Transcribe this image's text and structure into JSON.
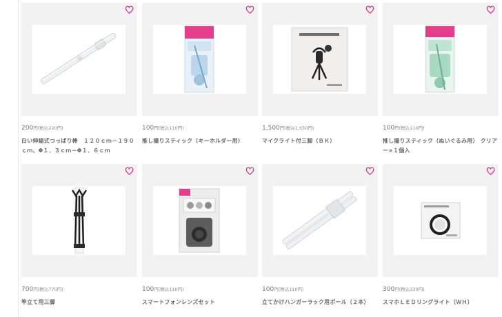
{
  "accent_color": "#e8318a",
  "products": [
    {
      "price": "200",
      "tax": "円(税込220円)",
      "name": "白い伸縮式つっぱり棒　１２０ｃｍ－１９０ｃｍ、Φ１．３ｃｍ－Φ１．６ｃｍ",
      "image": "white-tension-rod",
      "favorite_icon": "heart-outline-icon"
    },
    {
      "price": "100",
      "tax": "円(税込110円)",
      "name": "推し撮りスティック（キーホルダー用）",
      "image": "selfie-stick-keychain-package",
      "favorite_icon": "heart-outline-icon"
    },
    {
      "price": "1,500",
      "tax": "円(税込1,650円)",
      "name": "マイクライト付三脚（ＢＫ）",
      "image": "microphone-light-tripod-box",
      "favorite_icon": "heart-outline-icon"
    },
    {
      "price": "100",
      "tax": "円(税込110円)",
      "name": "推し撮りスティック（ぬいぐるみ用） クリアー×１個入",
      "image": "selfie-stick-plush-package",
      "favorite_icon": "heart-outline-icon"
    },
    {
      "price": "700",
      "tax": "円(税込770円)",
      "name": "竿立て用三脚",
      "image": "rod-stand-tripod",
      "favorite_icon": "heart-outline-icon"
    },
    {
      "price": "100",
      "tax": "円(税込110円)",
      "name": "スマートフォンレンズセット",
      "image": "smartphone-lens-set-package",
      "favorite_icon": "heart-outline-icon"
    },
    {
      "price": "100",
      "tax": "円(税込110円)",
      "name": "立てかけハンガーラック用ポール（２本）",
      "image": "hanger-rack-poles",
      "favorite_icon": "heart-outline-icon"
    },
    {
      "price": "300",
      "tax": "円(税込330円)",
      "name": "スマホＬＥＤリングライト（ＷＨ）",
      "image": "smartphone-led-ring-light-box",
      "favorite_icon": "heart-outline-icon"
    }
  ]
}
